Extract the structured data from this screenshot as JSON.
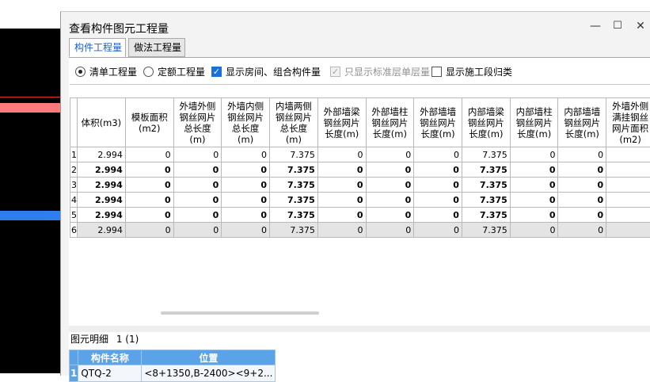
{
  "dialog": {
    "title": "查看构件图元工程量",
    "min_glyph": "—",
    "max_glyph": "☐",
    "close_glyph": "✕"
  },
  "tabs": [
    {
      "label": "构件工程量",
      "active": true
    },
    {
      "label": "做法工程量",
      "active": false
    }
  ],
  "options": {
    "radio_bill": {
      "label": "清单工程量",
      "checked": true
    },
    "radio_quota": {
      "label": "定额工程量",
      "checked": false
    },
    "check_rooms": {
      "label": "显示房间、组合构件量",
      "checked": true
    },
    "check_standard": {
      "label": "只显示标准层单层量",
      "checked": true,
      "disabled": true
    },
    "check_stage": {
      "label": "显示施工段归类",
      "checked": false
    }
  },
  "grid": {
    "columns": [
      "体积(m3)",
      "模板面积(m2)",
      "外墙外侧钢丝网片总长度(m)",
      "外墙内侧钢丝网片总长度(m)",
      "内墙两侧钢丝网片总长度(m)",
      "外部墙梁钢丝网片长度(m)",
      "外部墙柱钢丝网片长度(m)",
      "外部墙墙钢丝网片长度(m)",
      "内部墙梁钢丝网片长度(m)",
      "内部墙柱钢丝网片长度(m)",
      "内部墙墙钢丝网片长度(m)",
      "外墙外侧满挂钢丝网片面积(m2)"
    ],
    "rows": [
      {
        "num": "1",
        "bold": false,
        "selected": false,
        "values": [
          "2.994",
          "0",
          "0",
          "0",
          "7.375",
          "0",
          "0",
          "0",
          "7.375",
          "0",
          "0",
          ""
        ]
      },
      {
        "num": "2",
        "bold": true,
        "selected": false,
        "values": [
          "2.994",
          "0",
          "0",
          "0",
          "7.375",
          "0",
          "0",
          "0",
          "7.375",
          "0",
          "0",
          ""
        ]
      },
      {
        "num": "3",
        "bold": true,
        "selected": false,
        "values": [
          "2.994",
          "0",
          "0",
          "0",
          "7.375",
          "0",
          "0",
          "0",
          "7.375",
          "0",
          "0",
          ""
        ]
      },
      {
        "num": "4",
        "bold": true,
        "selected": false,
        "values": [
          "2.994",
          "0",
          "0",
          "0",
          "7.375",
          "0",
          "0",
          "0",
          "7.375",
          "0",
          "0",
          ""
        ]
      },
      {
        "num": "5",
        "bold": true,
        "selected": false,
        "values": [
          "2.994",
          "0",
          "0",
          "0",
          "7.375",
          "0",
          "0",
          "0",
          "7.375",
          "0",
          "0",
          ""
        ]
      },
      {
        "num": "6",
        "bold": false,
        "selected": true,
        "values": [
          "2.994",
          "0",
          "0",
          "0",
          "7.375",
          "0",
          "0",
          "0",
          "7.375",
          "0",
          "0",
          ""
        ]
      }
    ]
  },
  "detail": {
    "title": "图元明细",
    "count": "1 (1)",
    "columns": [
      "构件名称",
      "位置"
    ],
    "rows": [
      {
        "num": "1",
        "name": "QTQ-2",
        "position": "<8+1350,B-2400><9+2..."
      }
    ]
  }
}
